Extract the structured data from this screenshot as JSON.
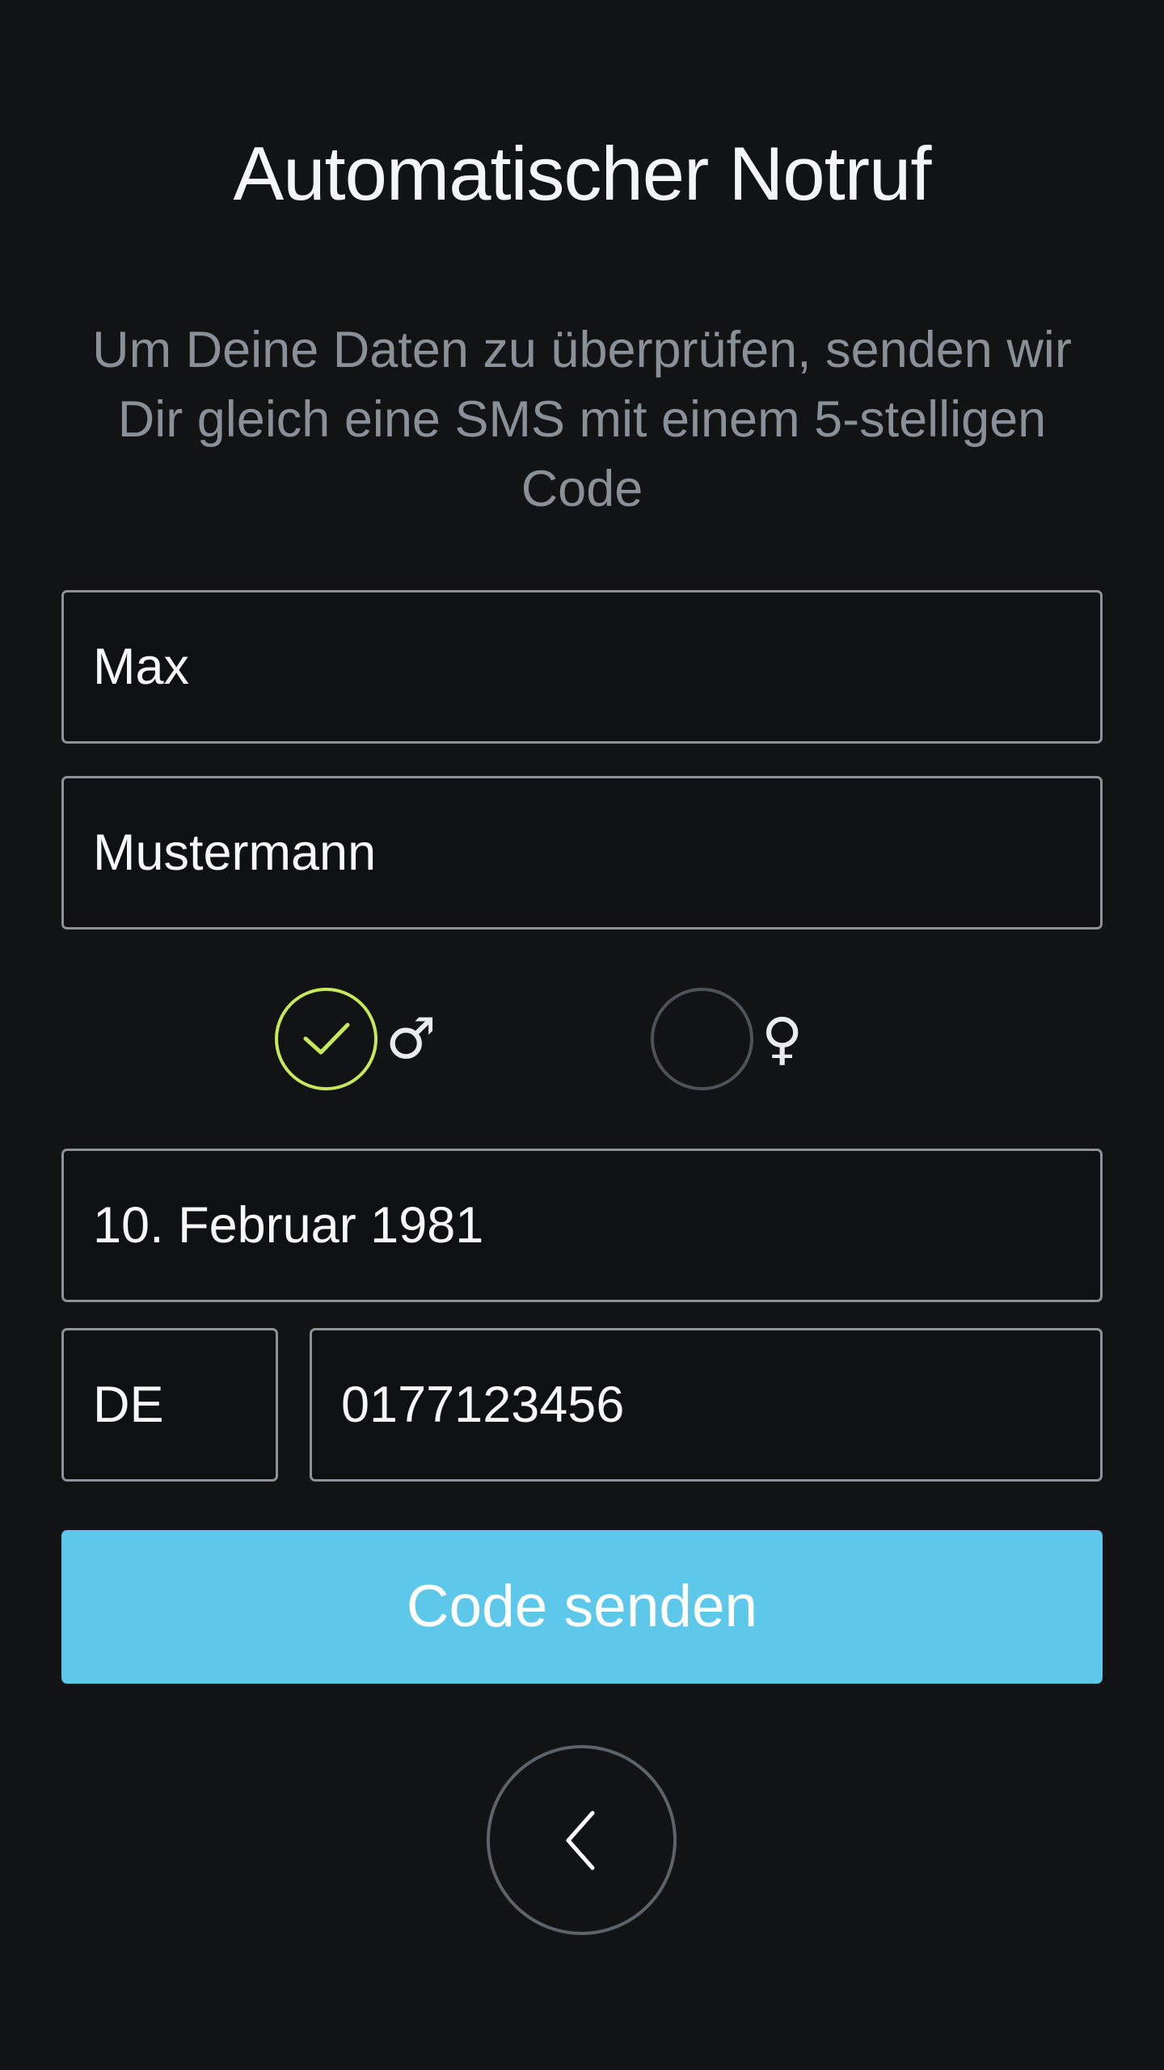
{
  "header": {
    "title": "Automatischer Notruf",
    "subtitle": "Um Deine Daten zu überprüfen, senden wir Dir gleich eine SMS mit einem 5-stelligen Code"
  },
  "form": {
    "first_name": "Max",
    "last_name": "Mustermann",
    "gender": {
      "selected": "male",
      "male_symbol": "♂",
      "female_symbol": "♀"
    },
    "birthdate": "10. Februar 1981",
    "country_code": "DE",
    "phone": "0177123456"
  },
  "actions": {
    "send_code_label": "Code senden"
  },
  "icons": {
    "male_radio_checkmark": "check-icon",
    "back": "chevron-left-icon"
  },
  "colors": {
    "background": "#121314",
    "accent_button": "#5ec8ea",
    "selected_radio": "#c8e95a",
    "field_border": "#8d9298"
  }
}
